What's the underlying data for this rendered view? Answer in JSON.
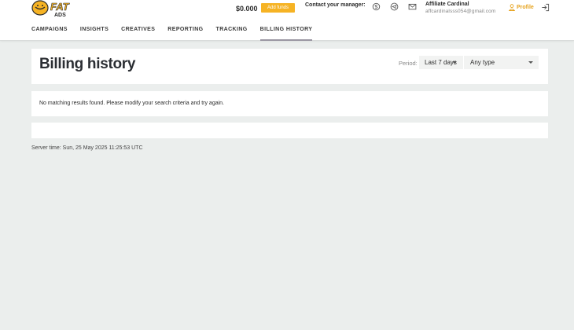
{
  "header": {
    "logo_text": "FAT ADS",
    "balance": "$0.000",
    "add_funds_label": "Add funds",
    "contact_label": "Contact your manager:",
    "contact_icons": [
      "skype-icon",
      "telegram-icon",
      "mail-icon"
    ],
    "user_name": "Affiliate Cardinal",
    "user_email": "affcardinalsss054@gmail.com",
    "profile_label": "Profile",
    "accent_color": "#f6b324"
  },
  "nav": {
    "items": [
      {
        "label": "CAMPAIGNS"
      },
      {
        "label": "INSIGHTS"
      },
      {
        "label": "CREATIVES"
      },
      {
        "label": "REPORTING"
      },
      {
        "label": "TRACKING"
      },
      {
        "label": "BILLING HISTORY",
        "active": true
      }
    ]
  },
  "main": {
    "title": "Billing history",
    "period_label": "Period:",
    "period_value": "Last 7 days",
    "type_value": "Any type",
    "empty_message": "No matching results found. Please modify your search criteria and try again.",
    "server_time": "Server time: Sun, 25 May 2025 11:25:53 UTC"
  }
}
